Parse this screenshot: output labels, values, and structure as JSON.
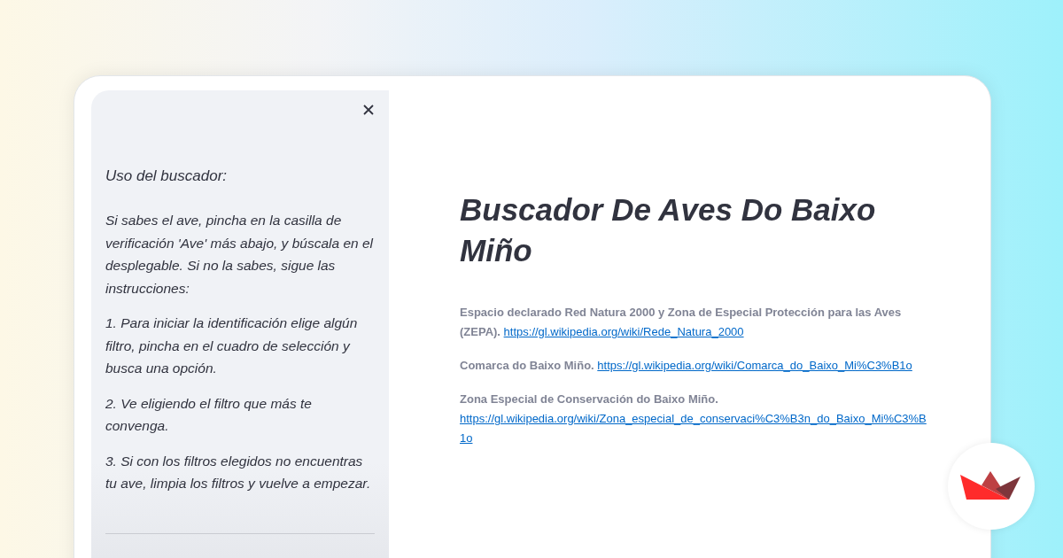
{
  "sidebar": {
    "heading": "Uso del buscador:",
    "paragraphs": [
      "Si sabes el ave, pincha en la casilla de verificación 'Ave' más abajo, y búscala en el desplegable. Si no la sabes, sigue las instrucciones:",
      "1. Para iniciar la identificación elige algún filtro, pincha en el cuadro de selección y busca una opción.",
      "2. Ve eligiendo el filtro que más te convenga.",
      "3. Si con los filtros elegidos no encuentras tu ave, limpia los filtros y vuelve a empezar."
    ]
  },
  "main": {
    "title": "Buscador De Aves Do Baixo Miño",
    "entries": [
      {
        "text": "Espacio declarado Red Natura 2000 y Zona de Especial Protección para las Aves (ZEPA).",
        "link": "https://gl.wikipedia.org/wiki/Rede_Natura_2000"
      },
      {
        "text": "Comarca do Baixo Miño.",
        "link": "https://gl.wikipedia.org/wiki/Comarca_do_Baixo_Mi%C3%B1o"
      },
      {
        "text": "Zona Especial de Conservación do Baixo Miño.",
        "link": "https://gl.wikipedia.org/wiki/Zona_especial_de_conservaci%C3%B3n_do_Baixo_Mi%C3%B1o"
      }
    ]
  }
}
